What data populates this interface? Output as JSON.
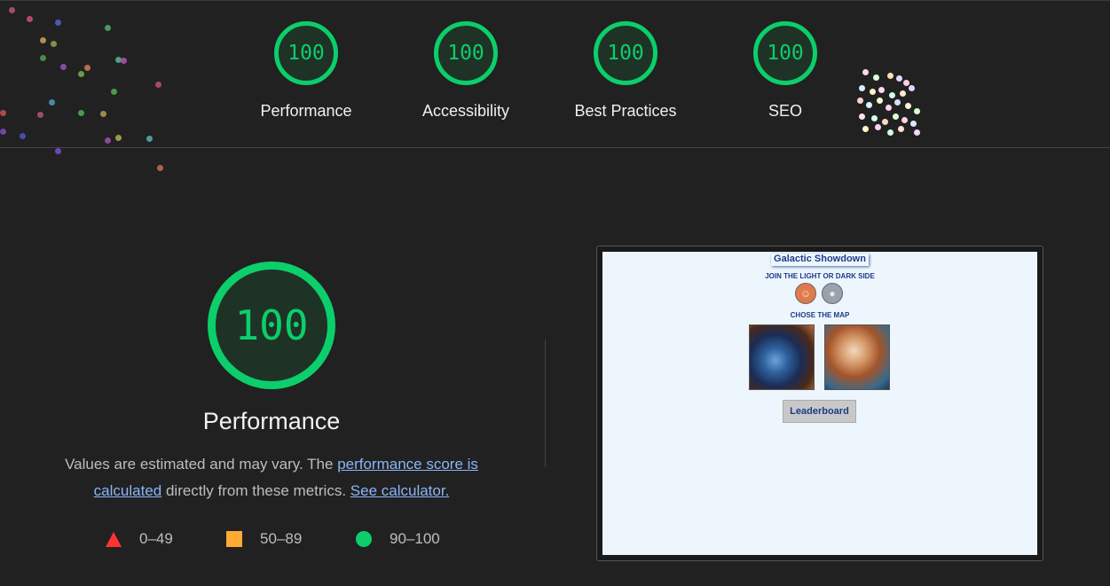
{
  "categories": [
    {
      "score": "100",
      "label": "Performance"
    },
    {
      "score": "100",
      "label": "Accessibility"
    },
    {
      "score": "100",
      "label": "Best Practices"
    },
    {
      "score": "100",
      "label": "SEO"
    }
  ],
  "main": {
    "score": "100",
    "title": "Performance",
    "desc_part1": "Values are estimated and may vary. The ",
    "link_score": "performance score is calculated",
    "desc_part2": " directly from these metrics. ",
    "link_calc": "See calculator."
  },
  "legend": {
    "poor": "0–49",
    "average": "50–89",
    "good": "90–100"
  },
  "colors": {
    "good": "#0cce6b",
    "average": "#ffaa33",
    "poor": "#ff3333",
    "link": "#8ab4f8"
  },
  "screenshot": {
    "title": "Galactic Showdown",
    "subtitle1": "JOIN THE LIGHT OR DARK SIDE",
    "subtitle2": "CHOSE THE MAP",
    "leaderboard": "Leaderboard",
    "light_icon": "yoda-icon",
    "dark_icon": "vader-icon"
  }
}
